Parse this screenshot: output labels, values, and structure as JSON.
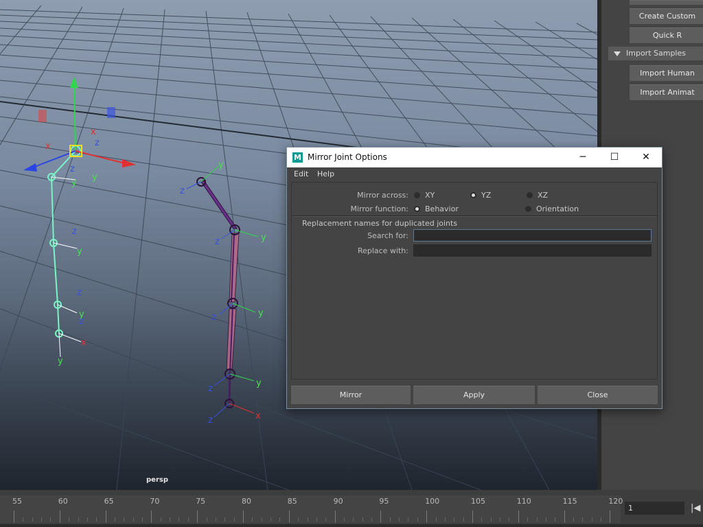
{
  "viewport": {
    "camera_label": "persp"
  },
  "right_panel": {
    "buttons": [
      "Create Custom",
      "Quick R"
    ],
    "section_label": "Import Samples",
    "section_buttons": [
      "Import Human",
      "Import Animat"
    ]
  },
  "timeline": {
    "ticks": [
      "55",
      "60",
      "65",
      "70",
      "75",
      "80",
      "85",
      "90",
      "95",
      "100",
      "105",
      "110",
      "115",
      "120"
    ],
    "current_frame": "1",
    "playback_icon": "step-back-icon"
  },
  "dialog": {
    "title": "Mirror Joint Options",
    "app_icon_letter": "M",
    "menu": [
      "Edit",
      "Help"
    ],
    "mirror_across": {
      "label": "Mirror across:",
      "options": [
        "XY",
        "YZ",
        "XZ"
      ],
      "selected": "YZ"
    },
    "mirror_function": {
      "label": "Mirror function:",
      "options": [
        "Behavior",
        "Orientation"
      ],
      "selected": "Behavior"
    },
    "replacement_header": "Replacement names for duplicated joints",
    "search_for": {
      "label": "Search for:",
      "value": ""
    },
    "replace_with": {
      "label": "Replace with:",
      "value": ""
    },
    "buttons": {
      "mirror": "Mirror",
      "apply": "Apply",
      "close": "Close"
    },
    "window_controls": {
      "minimize": "─",
      "maximize": "☐",
      "close": "✕"
    }
  },
  "colors": {
    "accent_focus": "#5d7a94",
    "maya_icon": "#0d9a94",
    "selected_joint": "#5cf0b0",
    "joint_purple": "#6a2f8a"
  }
}
